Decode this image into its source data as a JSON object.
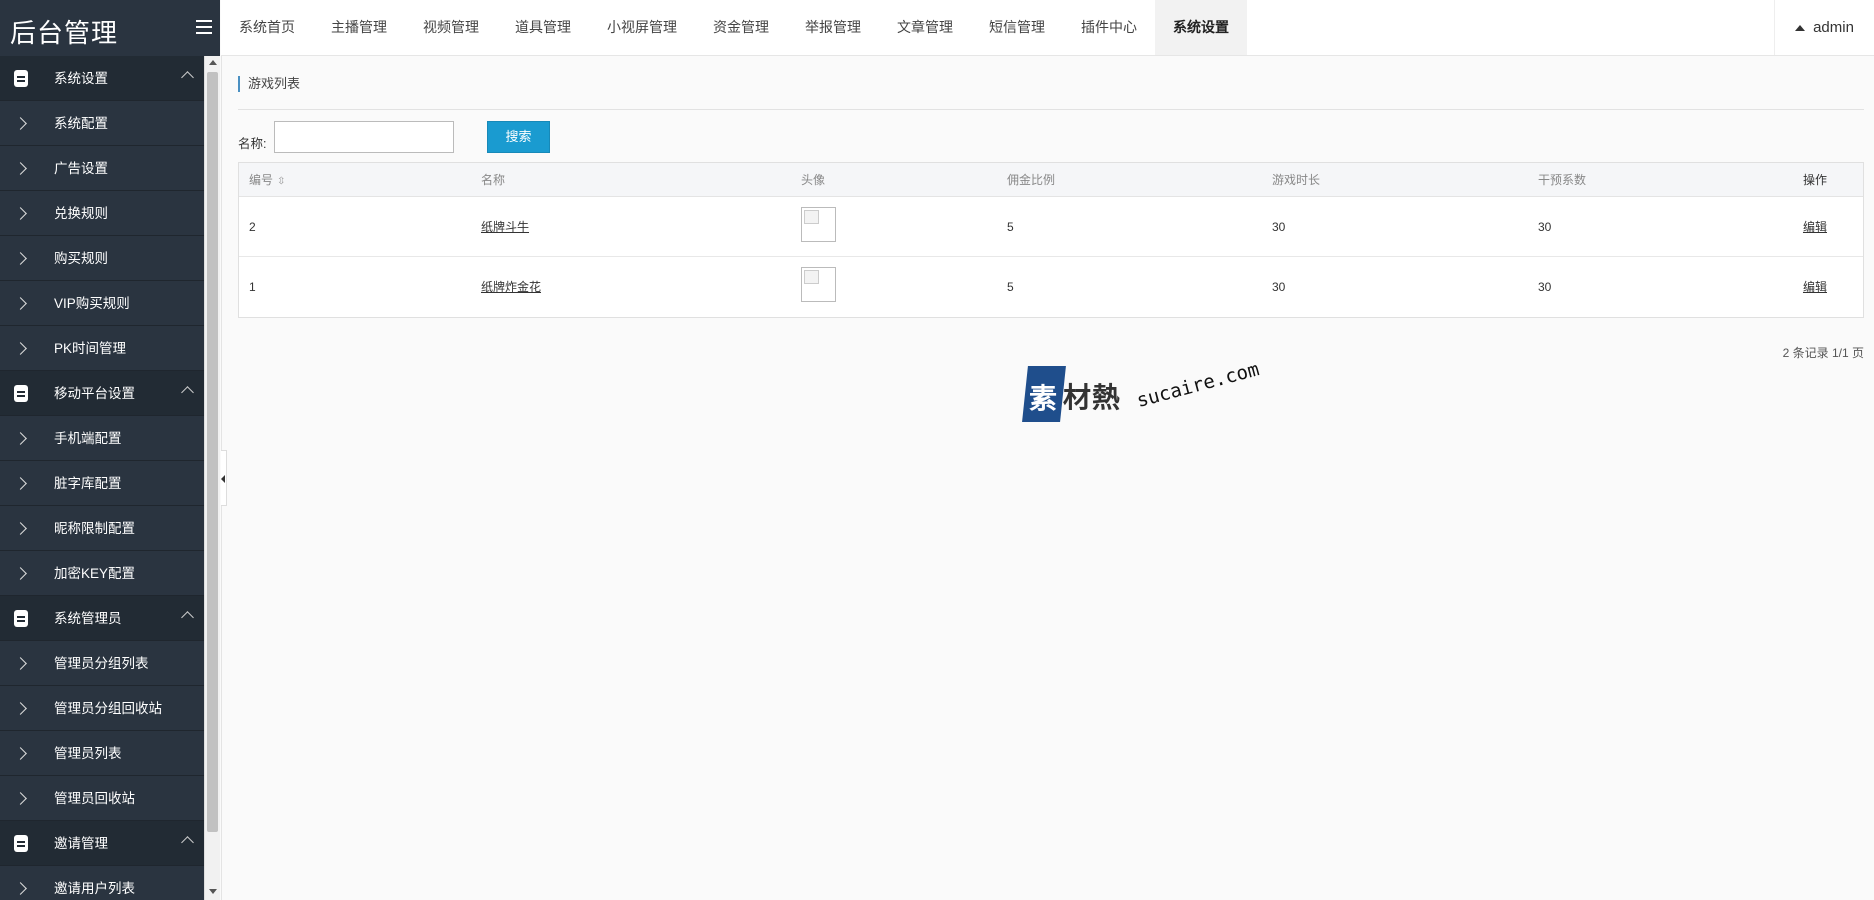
{
  "app": {
    "title": "后台管理"
  },
  "topnav": {
    "items": [
      {
        "label": "系统首页"
      },
      {
        "label": "主播管理"
      },
      {
        "label": "视频管理"
      },
      {
        "label": "道具管理"
      },
      {
        "label": "小视屏管理"
      },
      {
        "label": "资金管理"
      },
      {
        "label": "举报管理"
      },
      {
        "label": "文章管理"
      },
      {
        "label": "短信管理"
      },
      {
        "label": "插件中心"
      },
      {
        "label": "系统设置",
        "active": true
      }
    ],
    "user": "admin"
  },
  "sidebar": {
    "rows": [
      {
        "type": "group",
        "label": "系统设置"
      },
      {
        "type": "item",
        "label": "系统配置"
      },
      {
        "type": "item",
        "label": "广告设置"
      },
      {
        "type": "item",
        "label": "兑换规则"
      },
      {
        "type": "item",
        "label": "购买规则"
      },
      {
        "type": "item",
        "label": "VIP购买规则"
      },
      {
        "type": "item",
        "label": "PK时间管理"
      },
      {
        "type": "group",
        "label": "移动平台设置"
      },
      {
        "type": "item",
        "label": "手机端配置"
      },
      {
        "type": "item",
        "label": "脏字库配置"
      },
      {
        "type": "item",
        "label": "昵称限制配置"
      },
      {
        "type": "item",
        "label": "加密KEY配置"
      },
      {
        "type": "group",
        "label": "系统管理员"
      },
      {
        "type": "item",
        "label": "管理员分组列表"
      },
      {
        "type": "item",
        "label": "管理员分组回收站"
      },
      {
        "type": "item",
        "label": "管理员列表"
      },
      {
        "type": "item",
        "label": "管理员回收站"
      },
      {
        "type": "group",
        "label": "邀请管理"
      },
      {
        "type": "item",
        "label": "邀请用户列表"
      }
    ]
  },
  "main": {
    "title": "游戏列表",
    "search": {
      "label": "名称:",
      "value": "",
      "button": "搜索"
    },
    "table": {
      "headers": {
        "id": "编号",
        "name": "名称",
        "avatar": "头像",
        "commission": "佣金比例",
        "duration": "游戏时长",
        "coef": "干预系数",
        "action": "操作"
      },
      "rows": [
        {
          "id": "2",
          "name": "纸牌斗牛",
          "commission": "5",
          "duration": "30",
          "coef": "30",
          "action": "编辑"
        },
        {
          "id": "1",
          "name": "纸牌炸金花",
          "commission": "5",
          "duration": "30",
          "coef": "30",
          "action": "编辑"
        }
      ]
    },
    "pager": "2 条记录 1/1 页"
  },
  "watermark": {
    "badge": "素",
    "cn": "材熱",
    "en": "sucaire.com"
  },
  "colors": {
    "sidebar_bg": "#2a3440",
    "sidebar_group_bg": "#222b34",
    "accent": "#1a9bd0"
  }
}
